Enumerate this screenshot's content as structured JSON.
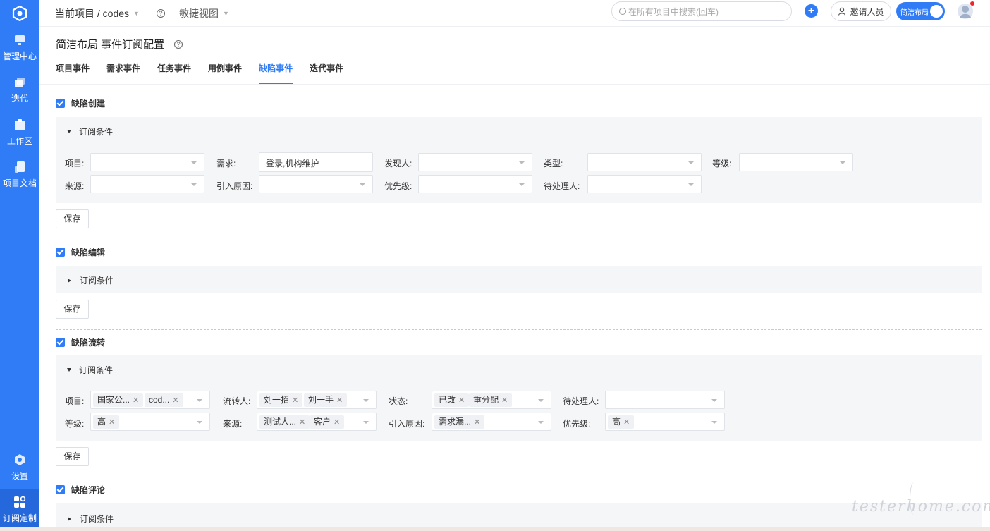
{
  "sidebar": {
    "items": [
      {
        "label": "管理中心",
        "icon": "monitor-icon"
      },
      {
        "label": "迭代",
        "icon": "stack-icon"
      },
      {
        "label": "工作区",
        "icon": "clipboard-icon"
      },
      {
        "label": "项目文档",
        "icon": "document-icon"
      }
    ],
    "settings_label": "设置",
    "subscribe_label": "订阅定制"
  },
  "header": {
    "project_crumb": "当前项目 / codes",
    "view_label": "敏捷视图",
    "search_placeholder": "在所有项目中搜索(回车)",
    "invite_label": "邀请人员",
    "toggle_label": "简洁布局"
  },
  "page": {
    "title": "简洁布局 事件订阅配置",
    "tabs": [
      "项目事件",
      "需求事件",
      "任务事件",
      "用例事件",
      "缺陷事件",
      "迭代事件"
    ],
    "active_tab": "缺陷事件"
  },
  "sections": {
    "create": {
      "title": "缺陷创建",
      "condition_label": "订阅条件",
      "fields": {
        "project": "项目:",
        "requirement": "需求:",
        "requirement_value": "登录,机构维护",
        "finder": "发现人:",
        "type": "类型:",
        "level": "等级:",
        "source": "来源:",
        "cause": "引入原因:",
        "priority": "优先级:",
        "handler": "待处理人:"
      },
      "save": "保存"
    },
    "edit": {
      "title": "缺陷编辑",
      "condition_label": "订阅条件",
      "save": "保存"
    },
    "flow": {
      "title": "缺陷流转",
      "condition_label": "订阅条件",
      "fields": {
        "project": "项目:",
        "project_tags": [
          "国家公...",
          "cod..."
        ],
        "transfer": "流转人:",
        "transfer_tags": [
          "刘一招",
          "刘一手"
        ],
        "status": "状态:",
        "status_tags": [
          "已改",
          "重分配"
        ],
        "handler": "待处理人:",
        "level": "等级:",
        "level_tags": [
          "高"
        ],
        "source": "来源:",
        "source_tags": [
          "测试人...",
          "客户"
        ],
        "cause": "引入原因:",
        "cause_tags": [
          "需求漏..."
        ],
        "priority": "优先级:",
        "priority_tags": [
          "高"
        ]
      },
      "save": "保存"
    },
    "comment": {
      "title": "缺陷评论",
      "condition_label": "订阅条件"
    }
  },
  "watermark": "testerhome.com",
  "colors": {
    "primary": "#2f7cf6",
    "panel_bg": "#f5f6f8"
  }
}
